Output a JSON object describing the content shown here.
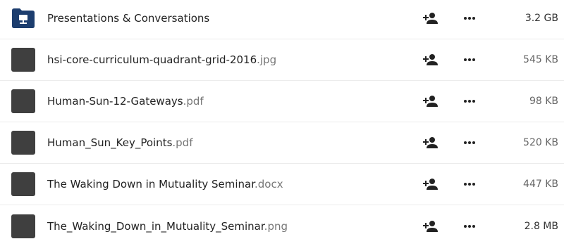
{
  "files": [
    {
      "name": "Presentations & Conversations",
      "ext": "",
      "size": "3.2 GB",
      "type_icon": "network-folder-icon",
      "size_color": "#333333"
    },
    {
      "name": "hsi-core-curriculum-quadrant-grid-2016",
      "ext": ".jpg",
      "size": "545 KB",
      "type_icon": "file-thumbnail",
      "size_color": "#666666"
    },
    {
      "name": "Human-Sun-12-Gateways",
      "ext": ".pdf",
      "size": "98 KB",
      "type_icon": "file-thumbnail",
      "size_color": "#666666"
    },
    {
      "name": "Human_Sun_Key_Points",
      "ext": ".pdf",
      "size": "520 KB",
      "type_icon": "file-thumbnail",
      "size_color": "#666666"
    },
    {
      "name": "The Waking Down in Mutuality Seminar",
      "ext": ".docx",
      "size": "447 KB",
      "type_icon": "file-thumbnail",
      "size_color": "#666666"
    },
    {
      "name": "The_Waking_Down_in_Mutuality_Seminar",
      "ext": ".png",
      "size": "2.8 MB",
      "type_icon": "file-thumbnail",
      "size_color": "#333333"
    }
  ],
  "actions": {
    "share_icon": "share-user-icon",
    "more_icon": "more-actions-icon"
  },
  "colors": {
    "folder": "#1c3d6e",
    "thumbnail": "#3f3f3f",
    "icon": "#222222",
    "divider": "#ececec"
  }
}
